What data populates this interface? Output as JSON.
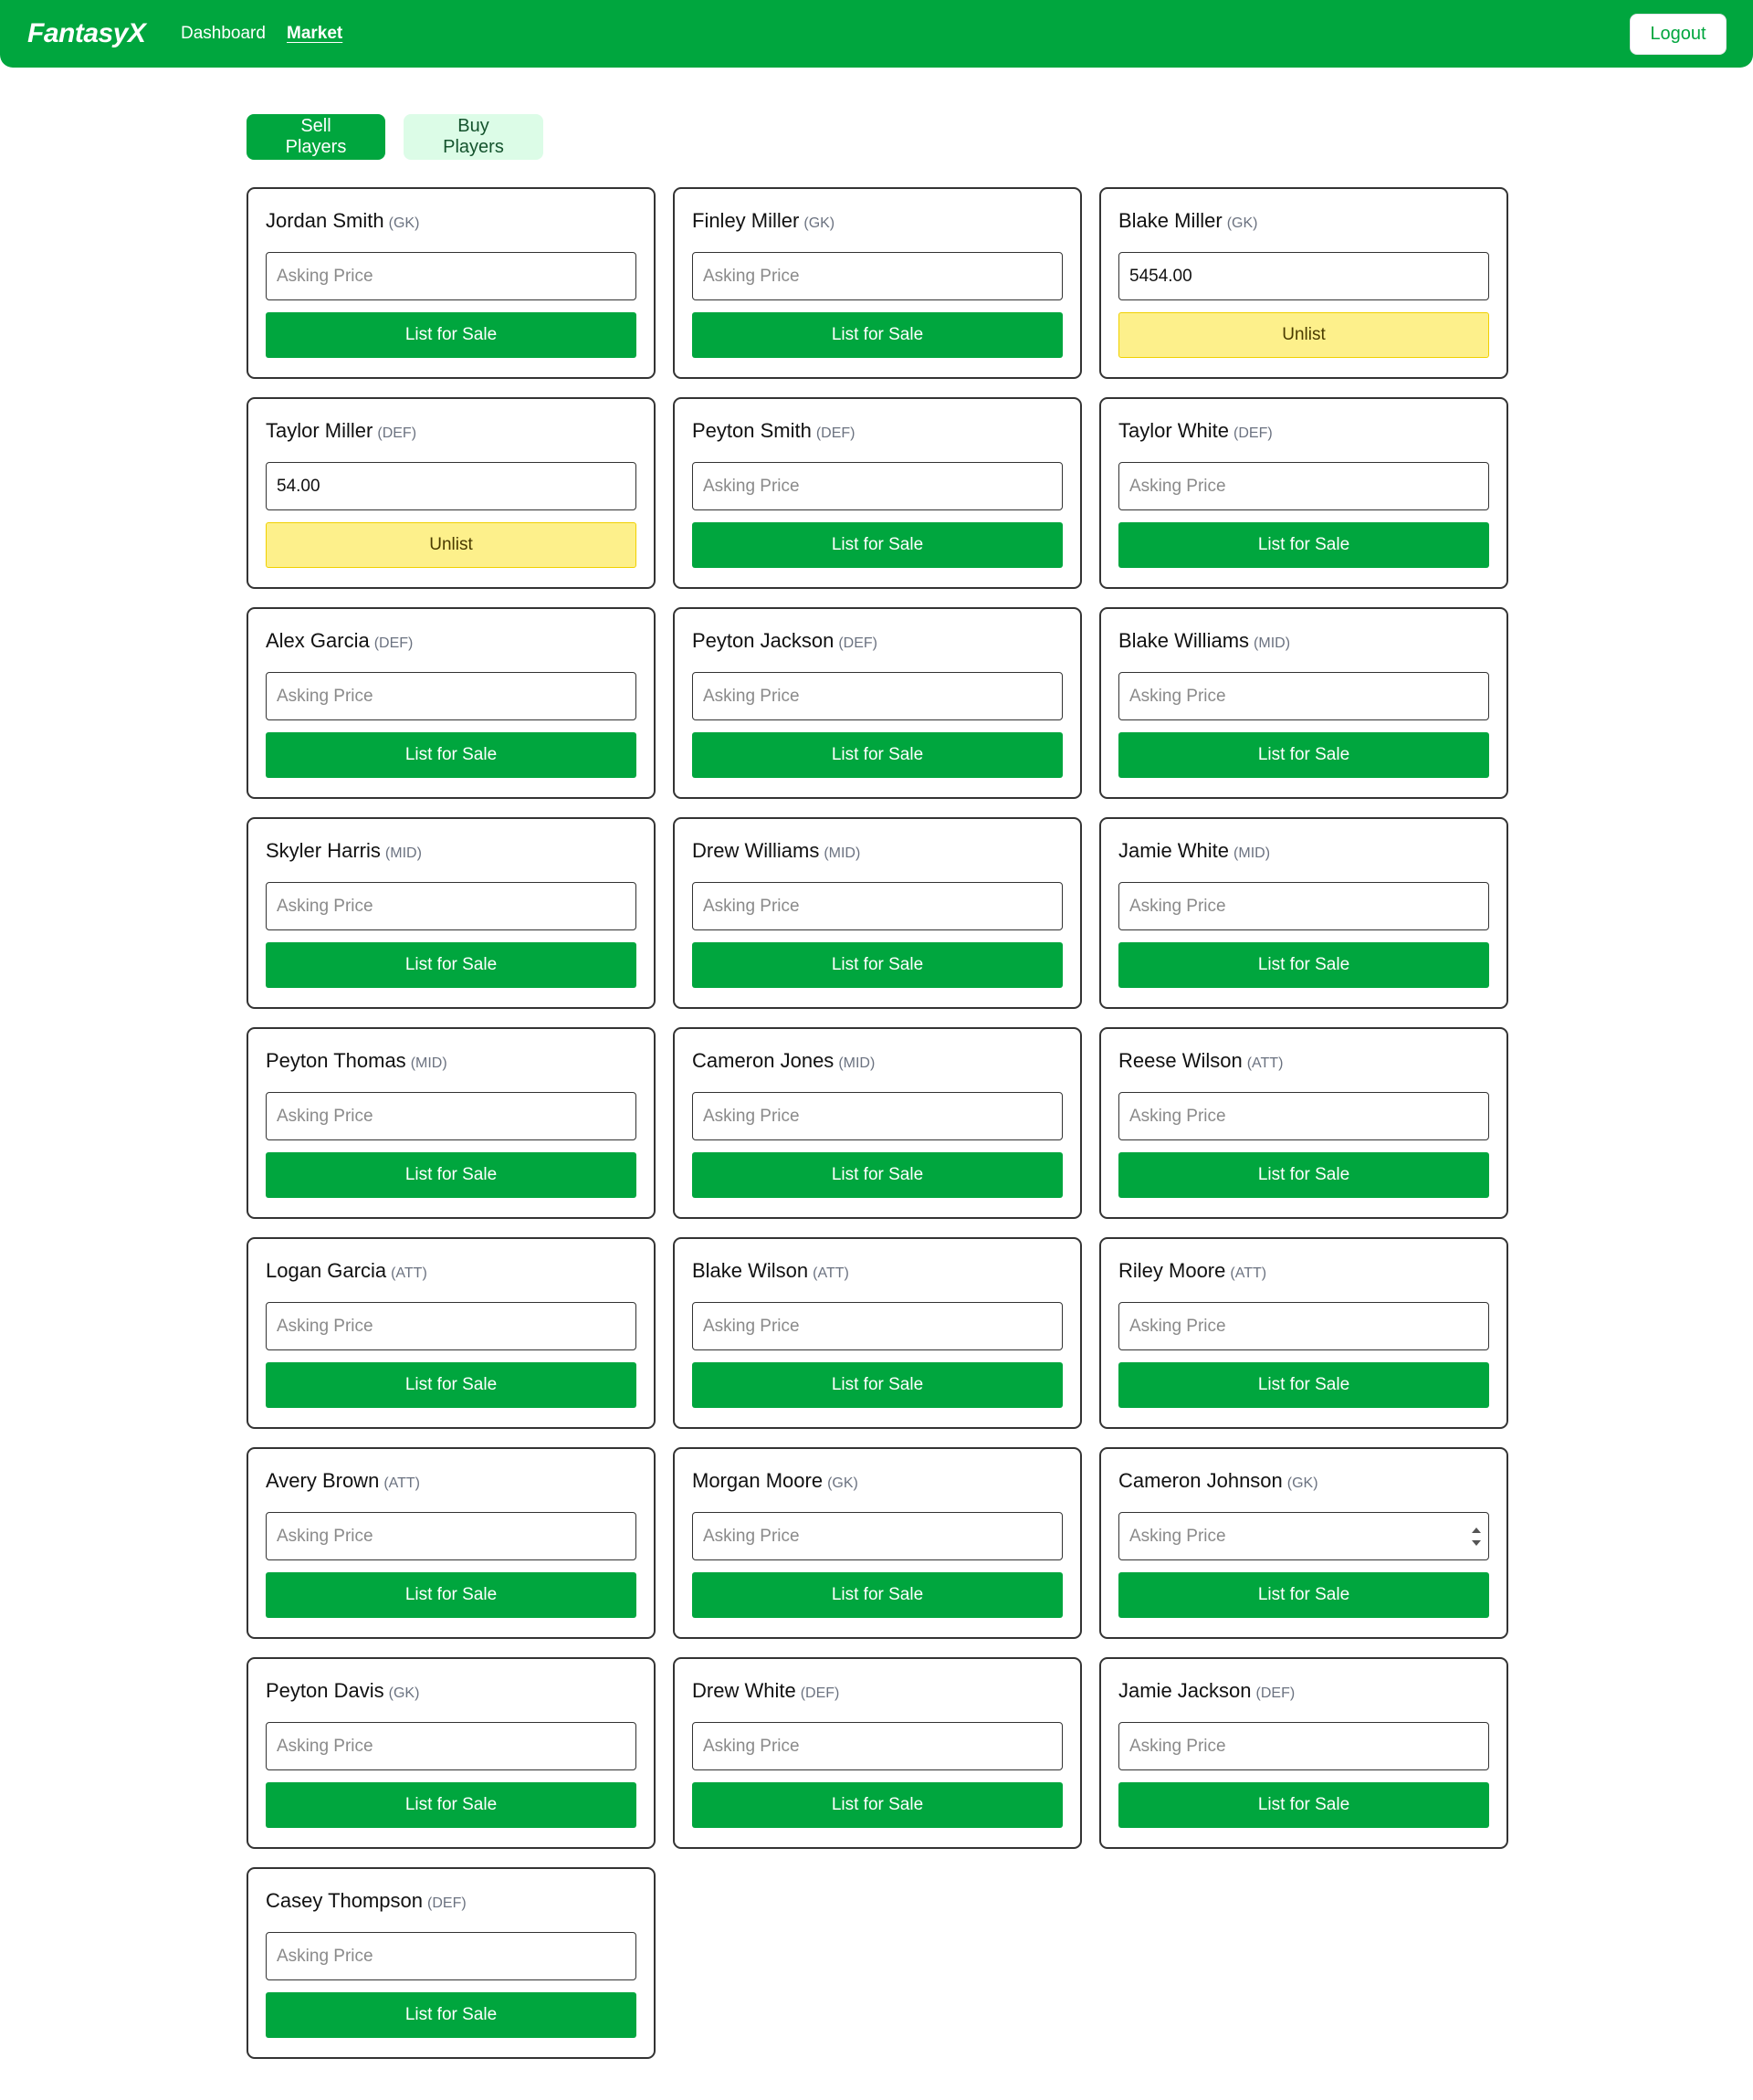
{
  "app": {
    "brand": "FantasyX",
    "nav": [
      {
        "label": "Dashboard",
        "active": false
      },
      {
        "label": "Market",
        "active": true
      }
    ],
    "logout_label": "Logout"
  },
  "tabs": {
    "sell_label": "Sell Players",
    "buy_label": "Buy Players",
    "active": "sell"
  },
  "input_placeholder": "Asking Price",
  "labels": {
    "list": "List for Sale",
    "unlist": "Unlist"
  },
  "colors": {
    "brand_green": "#00a63e",
    "unlist_yellow": "#fdf08b",
    "buy_tab_bg": "#dcfce7"
  },
  "players": [
    {
      "name": "Jordan Smith",
      "position": "(GK)",
      "price": "",
      "listed": false
    },
    {
      "name": "Finley Miller",
      "position": "(GK)",
      "price": "",
      "listed": false
    },
    {
      "name": "Blake Miller",
      "position": "(GK)",
      "price": "5454.00",
      "listed": true
    },
    {
      "name": "Taylor Miller",
      "position": "(DEF)",
      "price": "54.00",
      "listed": true
    },
    {
      "name": "Peyton Smith",
      "position": "(DEF)",
      "price": "",
      "listed": false
    },
    {
      "name": "Taylor White",
      "position": "(DEF)",
      "price": "",
      "listed": false
    },
    {
      "name": "Alex Garcia",
      "position": "(DEF)",
      "price": "",
      "listed": false
    },
    {
      "name": "Peyton Jackson",
      "position": "(DEF)",
      "price": "",
      "listed": false
    },
    {
      "name": "Blake Williams",
      "position": "(MID)",
      "price": "",
      "listed": false
    },
    {
      "name": "Skyler Harris",
      "position": "(MID)",
      "price": "",
      "listed": false
    },
    {
      "name": "Drew Williams",
      "position": "(MID)",
      "price": "",
      "listed": false
    },
    {
      "name": "Jamie White",
      "position": "(MID)",
      "price": "",
      "listed": false
    },
    {
      "name": "Peyton Thomas",
      "position": "(MID)",
      "price": "",
      "listed": false
    },
    {
      "name": "Cameron Jones",
      "position": "(MID)",
      "price": "",
      "listed": false
    },
    {
      "name": "Reese Wilson",
      "position": "(ATT)",
      "price": "",
      "listed": false
    },
    {
      "name": "Logan Garcia",
      "position": "(ATT)",
      "price": "",
      "listed": false
    },
    {
      "name": "Blake Wilson",
      "position": "(ATT)",
      "price": "",
      "listed": false
    },
    {
      "name": "Riley Moore",
      "position": "(ATT)",
      "price": "",
      "listed": false
    },
    {
      "name": "Avery Brown",
      "position": "(ATT)",
      "price": "",
      "listed": false
    },
    {
      "name": "Morgan Moore",
      "position": "(GK)",
      "price": "",
      "listed": false
    },
    {
      "name": "Cameron Johnson",
      "position": "(GK)",
      "price": "",
      "listed": false,
      "focused": true
    },
    {
      "name": "Peyton Davis",
      "position": "(GK)",
      "price": "",
      "listed": false
    },
    {
      "name": "Drew White",
      "position": "(DEF)",
      "price": "",
      "listed": false
    },
    {
      "name": "Jamie Jackson",
      "position": "(DEF)",
      "price": "",
      "listed": false
    },
    {
      "name": "Casey Thompson",
      "position": "(DEF)",
      "price": "",
      "listed": false
    }
  ]
}
